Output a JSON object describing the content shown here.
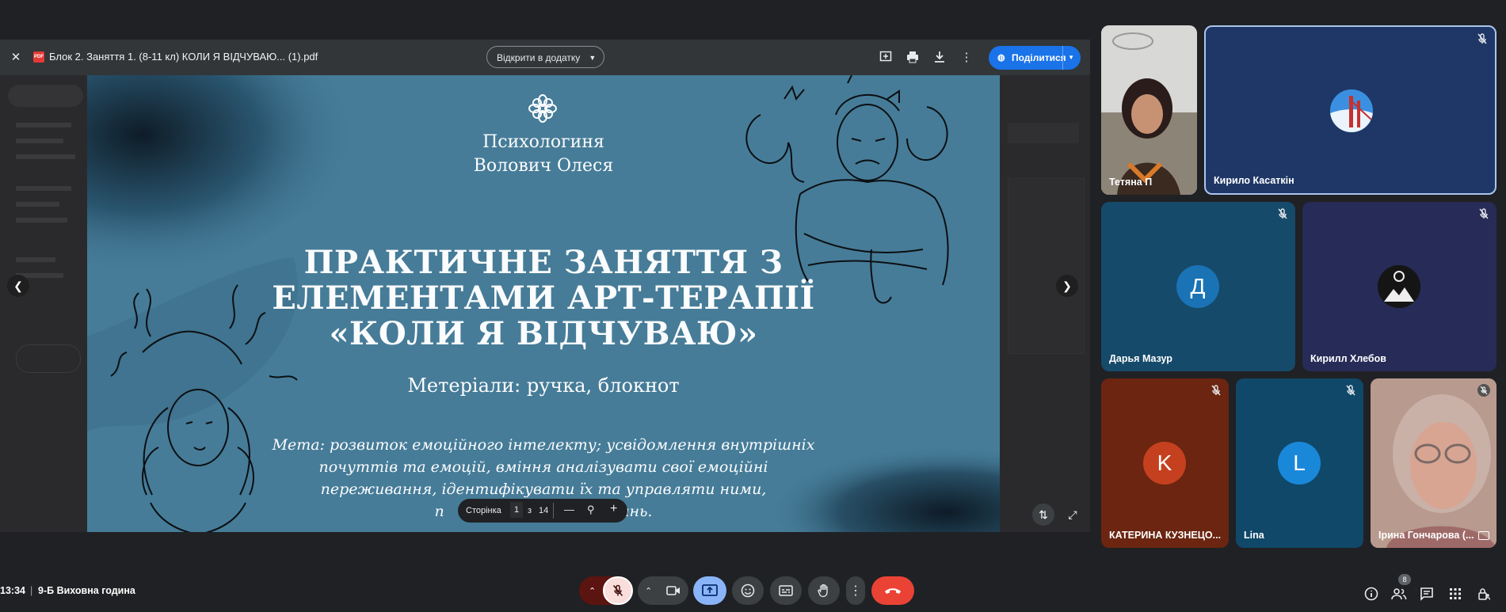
{
  "pdf_viewer": {
    "file_name": "Блок 2. Заняття 1. (8-11 кл) КОЛИ Я ВІДЧУВАЮ... (1).pdf",
    "open_with_label": "Відкрити в додатку",
    "share_label": "Поділитися"
  },
  "slide": {
    "author_line1": "Психологиня",
    "author_line2": "Волович Олеся",
    "title_line1": "ПРАКТИЧНЕ ЗАНЯТТЯ З",
    "title_line2": "ЕЛЕМЕНТАМИ АРТ-ТЕРАПІЇ",
    "title_line3": "«КОЛИ Я ВІДЧУВАЮ»",
    "materials": "Метеріали: ручка, блокнот",
    "goal_line1": "Мета: розвиток емоційного інтелекту; усвідомлення внутрішніх",
    "goal_line2": "почуттів та емоцій, вміння аналізувати свої емоційні",
    "goal_line3": "переживання, ідентифікувати їх та управляти ними,",
    "goal_line4": "п                                   вань."
  },
  "page_control": {
    "label": "Сторінка",
    "current": "1",
    "separator": "з",
    "total": "14",
    "minus": "—",
    "plus": "+"
  },
  "participants": [
    {
      "name": "Тетяна П",
      "muted": false,
      "kind": "video"
    },
    {
      "name": "Кирило Касаткін",
      "muted": true,
      "kind": "avatar"
    },
    {
      "name": "Дарья Мазур",
      "initial": "Д",
      "muted": true,
      "color": "#1a73b5"
    },
    {
      "name": "Кирилл Хлебов",
      "muted": true,
      "kind": "avatar"
    },
    {
      "name": "КАТЕРИНА КУЗНЕЦО...",
      "initial": "K",
      "muted": true,
      "color": "#c5401f"
    },
    {
      "name": "Lina",
      "initial": "L",
      "muted": true,
      "color": "#1a88d9"
    },
    {
      "name": "Ірина Гончарова (...",
      "muted": true,
      "kind": "video"
    }
  ],
  "meeting": {
    "time": "13:34",
    "separator": "|",
    "title": "9-Б Виховна година",
    "participants_count": "8"
  },
  "colors": {
    "slide_bg": "#467c98",
    "share_blue": "#1a73e8",
    "end_call_red": "#ea4335",
    "present_blue": "#8ab4f8"
  }
}
